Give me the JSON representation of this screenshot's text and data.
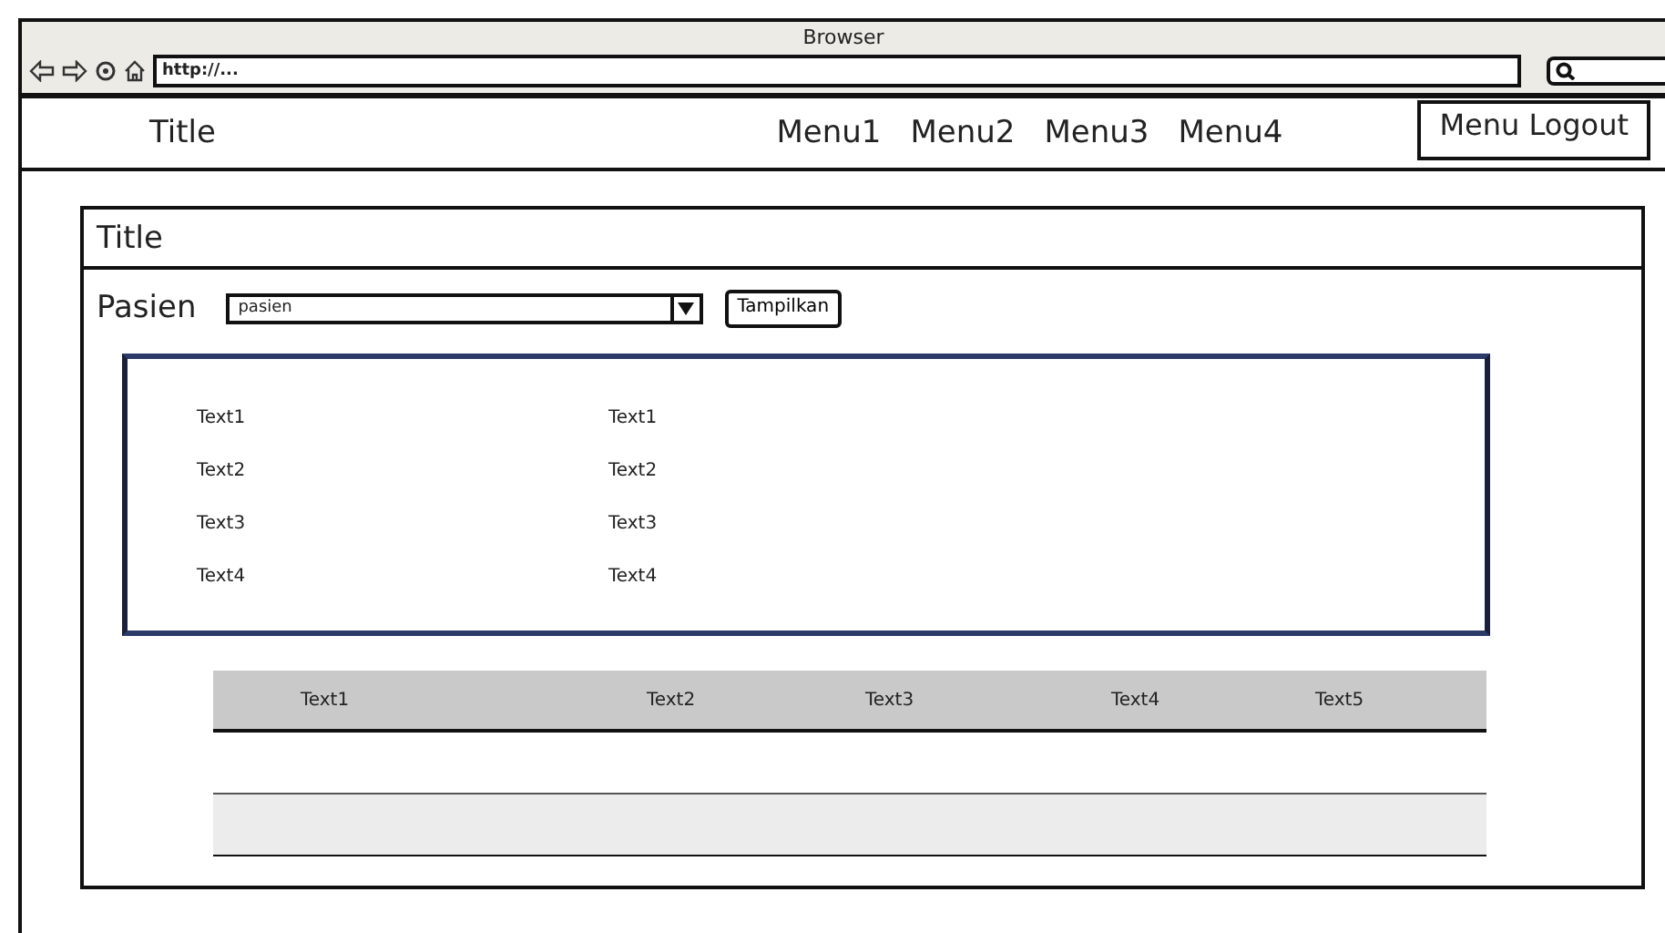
{
  "window": {
    "title": "Browser"
  },
  "address_bar": {
    "value": "http://..."
  },
  "nav": {
    "title": "Title",
    "menus": [
      "Menu1",
      "Menu2",
      "Menu3",
      "Menu4"
    ],
    "logout": "Menu Logout"
  },
  "panel": {
    "title": "Title",
    "filter_label": "Pasien",
    "dropdown_value": "pasien",
    "button": "Tampilkan"
  },
  "details": [
    {
      "label": "Text1",
      "value": "Text1"
    },
    {
      "label": "Text2",
      "value": "Text2"
    },
    {
      "label": "Text3",
      "value": "Text3"
    },
    {
      "label": "Text4",
      "value": "Text4"
    }
  ],
  "table": {
    "columns": [
      "Text1",
      "Text2",
      "Text3",
      "Text4",
      "Text5"
    ]
  }
}
